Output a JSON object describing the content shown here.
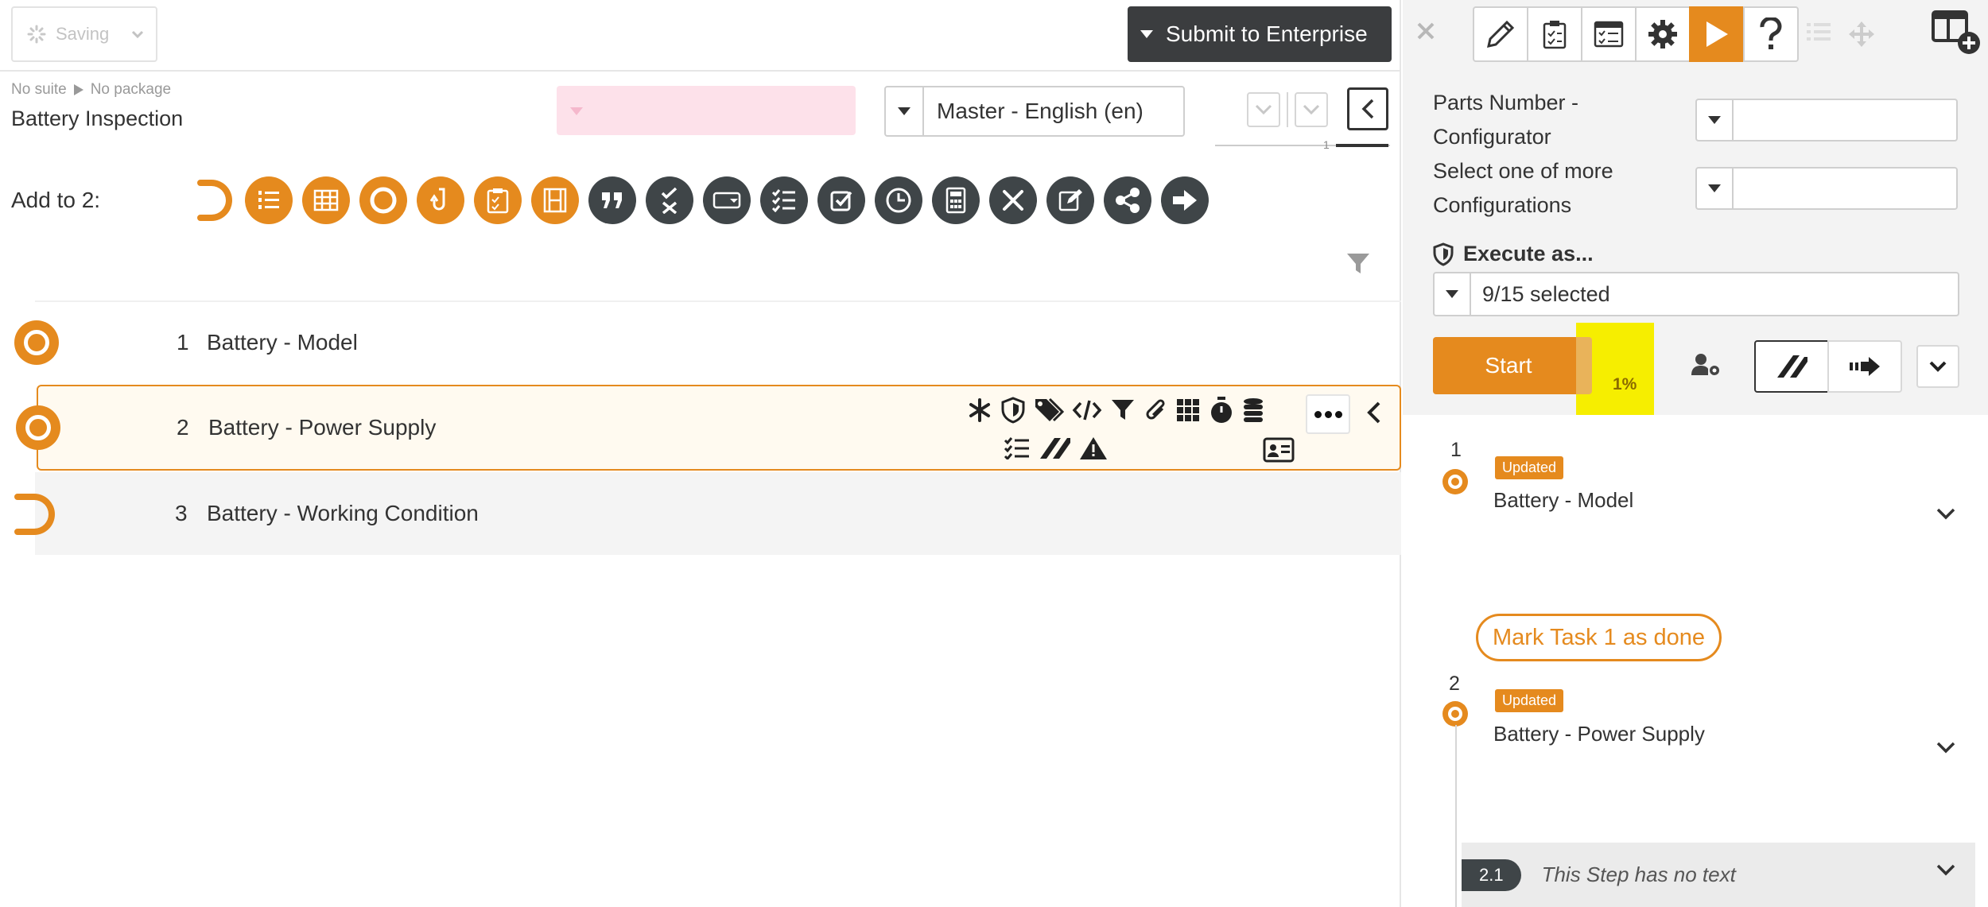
{
  "header": {
    "saving_label": "Saving",
    "submit_label": "Submit to Enterprise"
  },
  "breadcrumb": {
    "suite": "No suite",
    "package": "No package"
  },
  "document": {
    "title": "Battery Inspection"
  },
  "language": {
    "selected": "Master - English (en)"
  },
  "version": {
    "number": "1"
  },
  "add_to": {
    "label": "Add to 2:",
    "icons": [
      "half-circle-step-icon",
      "numbered-list-icon",
      "table-icon",
      "circle-step-icon",
      "link-step-icon",
      "clipboard-check-icon",
      "film-icon",
      "quote-icon",
      "pass-fail-icon",
      "dropdown-field-icon",
      "checklist-icon",
      "checkbox-icon",
      "clock-icon",
      "calculator-icon",
      "tools-icon",
      "signature-edit-icon",
      "share-icon",
      "arrow-right-icon"
    ]
  },
  "steps": [
    {
      "number": "1",
      "title": "Battery - Model"
    },
    {
      "number": "2",
      "title": "Battery - Power Supply"
    },
    {
      "number": "3",
      "title": "Battery - Working Condition"
    }
  ],
  "row_tools": {
    "top": [
      "asterisk-icon",
      "shield-icon",
      "tags-icon",
      "code-icon",
      "filter-icon",
      "paperclip-icon",
      "grid-icon",
      "stopwatch-icon",
      "database-icon"
    ],
    "bottom": [
      "checklist-icon",
      "signature-icon",
      "warning-icon"
    ]
  },
  "run_panel": {
    "parts_label": "Parts Number - Configurator",
    "select_label": "Select one of more Configurations",
    "execute_label": "Execute as...",
    "execute_value": "9/15 selected",
    "start_label": "Start",
    "progress": "1%",
    "progress_value": 0.01
  },
  "timeline": [
    {
      "number": "1",
      "badge": "Updated",
      "title": "Battery - Model"
    },
    {
      "number": "2",
      "badge": "Updated",
      "title": "Battery - Power Supply"
    }
  ],
  "mark_done_label": "Mark Task 1 as done",
  "substep": {
    "number": "2.1",
    "text": "This Step has no text"
  },
  "colors": {
    "accent": "#e58a1e",
    "dark": "#3f4548",
    "highlight": "#f6ee00"
  }
}
